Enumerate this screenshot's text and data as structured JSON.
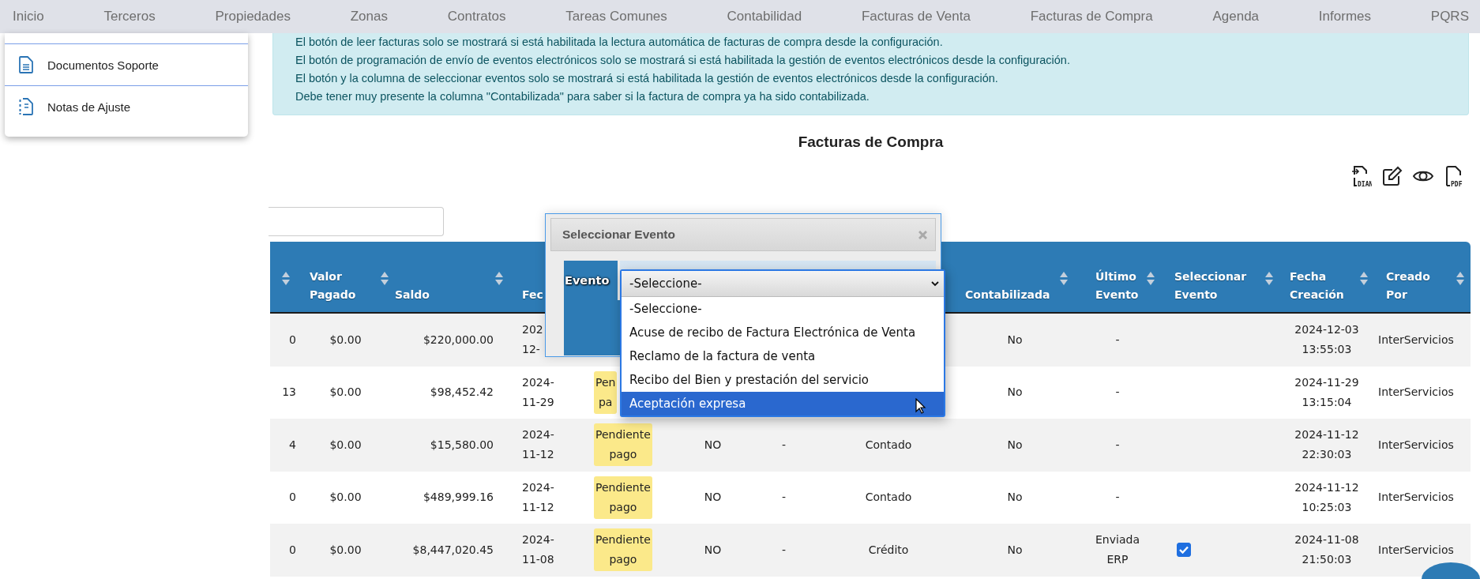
{
  "nav": {
    "items": [
      "Inicio",
      "Terceros",
      "Propiedades",
      "Zonas",
      "Contratos",
      "Tareas Comunes",
      "Contabilidad",
      "Facturas de Venta",
      "Facturas de Compra",
      "Agenda",
      "Informes",
      "PQRS"
    ]
  },
  "side_menu": {
    "items": [
      {
        "label": "Documentos Soporte",
        "kind": "document"
      },
      {
        "label": "Notas de Ajuste",
        "kind": "notes"
      }
    ]
  },
  "notice": {
    "lines": [
      "El botón de leer facturas solo se mostrará si está habilitada la lectura automática de facturas de compra desde la configuración.",
      "El botón de programación de envío de eventos electrónicos solo se mostrará si está habilitada la gestión de eventos electrónicos desde la configuración.",
      "El botón y la columna de seleccionar eventos solo se mostrará si está habilitada la gestión de eventos electrónicos desde la configuración.",
      "Debe tener muy presente la columna \"Contabilizada\" para saber si la factura de compra ya ha sido contabilizada."
    ]
  },
  "page_title": "Facturas de Compra",
  "toolbar": {
    "icons": [
      {
        "kind": "dian",
        "label": "DIAN"
      },
      {
        "kind": "edit"
      },
      {
        "kind": "view"
      },
      {
        "kind": "pdf",
        "label": "PDF"
      }
    ]
  },
  "table": {
    "columns": [
      {
        "sortable": true
      },
      {
        "label": "Valor Pagado",
        "sortable": true
      },
      {
        "label": "Saldo",
        "sortable": true
      },
      {
        "label": "Fec"
      },
      {
        "label": "Contabilizada",
        "sortable": true
      },
      {
        "label": "Último Evento",
        "sortable": true
      },
      {
        "label": "Seleccionar Evento",
        "sortable": true
      },
      {
        "label": "Fecha Creación",
        "sortable": true
      },
      {
        "label": "Creado Por",
        "sortable": true
      }
    ],
    "rows": [
      {
        "col_1": "0",
        "valor_pagado": "$0.00",
        "saldo": "$220,000.00",
        "fecha": [
          "202",
          "12-"
        ],
        "contabilizada": "No",
        "ultimo_evento": [
          "-"
        ],
        "fecha_creacion": [
          "2024-12-03",
          "13:55:03"
        ],
        "creado_por": "InterServicios"
      },
      {
        "col_1": "13",
        "valor_pagado": "$0.00",
        "saldo": "$98,452.42",
        "fecha": [
          "2024-",
          "11-29"
        ],
        "estado": [
          "Pen",
          "pa"
        ],
        "contabilizada": "No",
        "ultimo_evento": [
          "-"
        ],
        "fecha_creacion": [
          "2024-11-29",
          "13:15:04"
        ],
        "creado_por": "InterServicios"
      },
      {
        "col_1": "4",
        "valor_pagado": "$0.00",
        "saldo": "$15,580.00",
        "fecha": [
          "2024-",
          "11-12"
        ],
        "estado": [
          "Pendiente",
          "pago"
        ],
        "col_6": "NO",
        "col_7": "-",
        "col_8": "Contado",
        "contabilizada": "No",
        "ultimo_evento": [
          "-"
        ],
        "fecha_creacion": [
          "2024-11-12",
          "22:30:03"
        ],
        "creado_por": "InterServicios"
      },
      {
        "col_1": "0",
        "valor_pagado": "$0.00",
        "saldo": "$489,999.16",
        "fecha": [
          "2024-",
          "11-12"
        ],
        "estado": [
          "Pendiente",
          "pago"
        ],
        "col_6": "NO",
        "col_7": "-",
        "col_8": "Contado",
        "contabilizada": "No",
        "ultimo_evento": [
          "-"
        ],
        "fecha_creacion": [
          "2024-11-12",
          "10:25:03"
        ],
        "creado_por": "InterServicios"
      },
      {
        "col_1": "0",
        "valor_pagado": "$0.00",
        "saldo": "$8,447,020.45",
        "fecha": [
          "2024-",
          "11-08"
        ],
        "estado": [
          "Pendiente",
          "pago"
        ],
        "col_6": "NO",
        "col_7": "-",
        "col_8": "Crédito",
        "contabilizada": "No",
        "ultimo_evento": [
          "Enviada",
          "ERP"
        ],
        "select_checkbox": {
          "checked": true
        },
        "fecha_creacion": [
          "2024-11-08",
          "21:50:03"
        ],
        "creado_por": "InterServicios"
      }
    ]
  },
  "modal": {
    "title": "Seleccionar Evento",
    "field_label": "Evento",
    "select": {
      "value": "-Seleccione-",
      "options": [
        {
          "label": "-Seleccione-",
          "highlighted": false
        },
        {
          "label": "Acuse de recibo de Factura Electrónica de Venta",
          "highlighted": false
        },
        {
          "label": "Reclamo de la factura de venta",
          "highlighted": false
        },
        {
          "label": "Recibo del Bien y prestación del servicio",
          "highlighted": false
        },
        {
          "label": "Aceptación expresa",
          "highlighted": true
        }
      ]
    }
  }
}
